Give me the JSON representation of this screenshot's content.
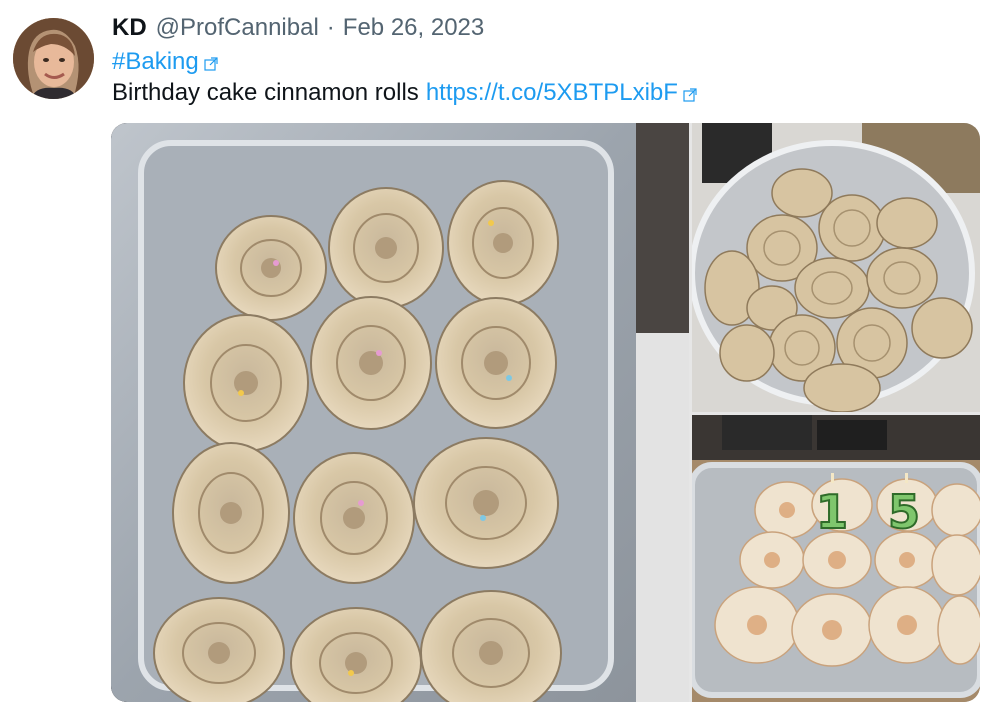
{
  "tweet": {
    "display_name": "KD",
    "handle": "@ProfCannibal",
    "separator": "·",
    "date": "Feb 26, 2023",
    "hashtag": "#Baking",
    "text": "Birthday cake cinnamon rolls",
    "link": "https://t.co/5XBTPLxibF",
    "avatar_icon": "avatar-photo",
    "external_link_icon": "external-link-icon"
  },
  "media": {
    "images": [
      {
        "description": "unbaked-cinnamon-rolls-in-glass-dish"
      },
      {
        "description": "unbaked-rolls-in-round-glass-dish"
      },
      {
        "description": "frosted-rolls-with-candles"
      }
    ],
    "candles": [
      "1",
      "5"
    ]
  },
  "colors": {
    "link": "#1d9bf0",
    "secondary_text": "#536471",
    "primary_text": "#0f1419"
  }
}
